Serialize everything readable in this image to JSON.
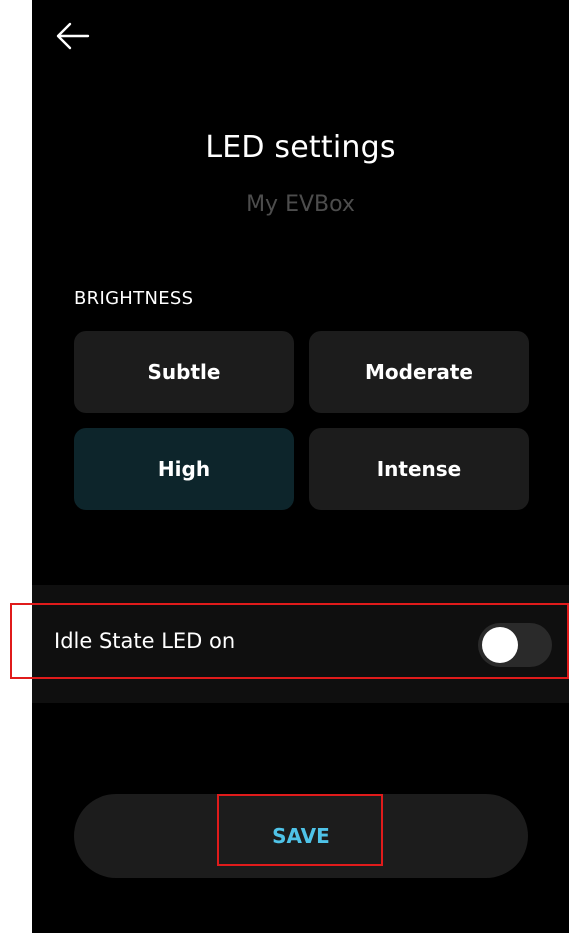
{
  "header": {
    "back_icon": "arrow-left-icon"
  },
  "title": "LED settings",
  "subtitle": "My EVBox",
  "brightness": {
    "label": "BRIGHTNESS",
    "options": [
      {
        "label": "Subtle",
        "selected": false
      },
      {
        "label": "Moderate",
        "selected": false
      },
      {
        "label": "High",
        "selected": true
      },
      {
        "label": "Intense",
        "selected": false
      }
    ]
  },
  "idle_state": {
    "label": "Idle State LED on",
    "on": false
  },
  "save_label": "SAVE",
  "colors": {
    "background": "#000000",
    "tile": "#1c1c1c",
    "tile_selected": "#0d252b",
    "accent": "#4fc3e8",
    "highlight": "#e01b1b"
  }
}
